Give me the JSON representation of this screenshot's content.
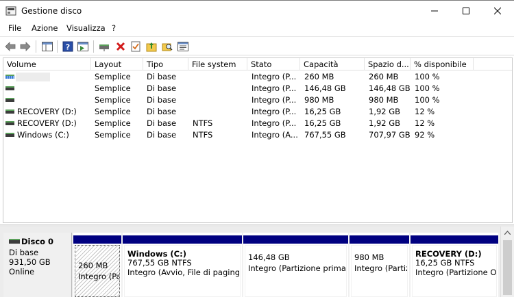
{
  "window": {
    "title": "Gestione disco"
  },
  "menu": [
    "File",
    "Azione",
    "Visualizza",
    "?"
  ],
  "toolbar": {
    "icons": [
      "back-arrow-icon",
      "forward-arrow-icon",
      "console-tree-icon",
      "help-icon",
      "show-hide-icon",
      "connect-icon",
      "delete-icon",
      "check-icon",
      "folder-up-icon",
      "search-folder-icon",
      "properties-icon"
    ]
  },
  "table": {
    "columns": [
      "Volume",
      "Layout",
      "Tipo",
      "File system",
      "Stato",
      "Capacità",
      "Spazio d...",
      "% disponibile"
    ],
    "rows": [
      {
        "volume": "",
        "layout": "Semplice",
        "tipo": "Di base",
        "fs": "",
        "stato": "Integro (P...",
        "capacita": "260 MB",
        "spazio": "260 MB",
        "perc": "100 %"
      },
      {
        "volume": "",
        "layout": "Semplice",
        "tipo": "Di base",
        "fs": "",
        "stato": "Integro (P...",
        "capacita": "146,48 GB",
        "spazio": "146,48 GB",
        "perc": "100 %"
      },
      {
        "volume": "",
        "layout": "Semplice",
        "tipo": "Di base",
        "fs": "",
        "stato": "Integro (P...",
        "capacita": "980 MB",
        "spazio": "980 MB",
        "perc": "100 %"
      },
      {
        "volume": "RECOVERY (D:)",
        "layout": "Semplice",
        "tipo": "Di base",
        "fs": "",
        "stato": "Integro (P...",
        "capacita": "16,25 GB",
        "spazio": "1,92 GB",
        "perc": "12 %"
      },
      {
        "volume": "RECOVERY (D:)",
        "layout": "Semplice",
        "tipo": "Di base",
        "fs": "NTFS",
        "stato": "Integro (P...",
        "capacita": "16,25 GB",
        "spazio": "1,92 GB",
        "perc": "12 %"
      },
      {
        "volume": "Windows (C:)",
        "layout": "Semplice",
        "tipo": "Di base",
        "fs": "NTFS",
        "stato": "Integro (A...",
        "capacita": "767,55 GB",
        "spazio": "707,97 GB",
        "perc": "92 %"
      }
    ]
  },
  "disk": {
    "name": "Disco 0",
    "type": "Di base",
    "size": "931,50 GB",
    "status": "Online",
    "partitions": [
      {
        "name": "",
        "size": "260 MB",
        "desc": "Integro (Pa"
      },
      {
        "name": "Windows  (C:)",
        "size": "767,55 GB NTFS",
        "desc": "Integro (Avvio, File di paging, I"
      },
      {
        "name": "",
        "size": "146,48 GB",
        "desc": "Integro (Partizione primari"
      },
      {
        "name": "",
        "size": "980 MB",
        "desc": "Integro (Partiz"
      },
      {
        "name": "RECOVERY  (D:)",
        "size": "16,25 GB NTFS",
        "desc": "Integro (Partizione OE"
      }
    ]
  },
  "colors": {
    "partition_header": "#000080",
    "accent_green": "#5a9f5a"
  }
}
